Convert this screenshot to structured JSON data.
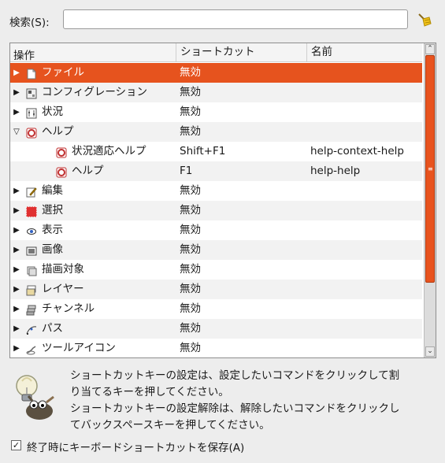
{
  "search": {
    "label": "検索(S):",
    "value": "",
    "placeholder": ""
  },
  "tree": {
    "columns": [
      "操作",
      "ショートカット",
      "名前"
    ],
    "rows": [
      {
        "expander": "▶",
        "icon": "file-icon",
        "name": "ファイル",
        "shortcut": "無効",
        "action": "",
        "selected": true,
        "depth": 0
      },
      {
        "expander": "▶",
        "icon": "configuration-icon",
        "name": "コンフィグレーション",
        "shortcut": "無効",
        "action": "",
        "depth": 0
      },
      {
        "expander": "▶",
        "icon": "status-icon",
        "name": "状況",
        "shortcut": "無効",
        "action": "",
        "depth": 0
      },
      {
        "expander": "▽",
        "icon": "help-icon",
        "name": "ヘルプ",
        "shortcut": "無効",
        "action": "",
        "depth": 0
      },
      {
        "expander": "",
        "icon": "help-icon",
        "name": "状況適応ヘルプ",
        "shortcut": "Shift+F1",
        "action": "help-context-help",
        "depth": 1
      },
      {
        "expander": "",
        "icon": "help-icon",
        "name": "ヘルプ",
        "shortcut": "F1",
        "action": "help-help",
        "depth": 1
      },
      {
        "expander": "▶",
        "icon": "edit-icon",
        "name": "編集",
        "shortcut": "無効",
        "action": "",
        "depth": 0
      },
      {
        "expander": "▶",
        "icon": "select-icon",
        "name": "選択",
        "shortcut": "無効",
        "action": "",
        "depth": 0
      },
      {
        "expander": "▶",
        "icon": "view-icon",
        "name": "表示",
        "shortcut": "無効",
        "action": "",
        "depth": 0
      },
      {
        "expander": "▶",
        "icon": "image-icon",
        "name": "画像",
        "shortcut": "無効",
        "action": "",
        "depth": 0
      },
      {
        "expander": "▶",
        "icon": "drawable-icon",
        "name": "描画対象",
        "shortcut": "無効",
        "action": "",
        "depth": 0
      },
      {
        "expander": "▶",
        "icon": "layer-icon",
        "name": "レイヤー",
        "shortcut": "無効",
        "action": "",
        "depth": 0
      },
      {
        "expander": "▶",
        "icon": "channel-icon",
        "name": "チャンネル",
        "shortcut": "無効",
        "action": "",
        "depth": 0
      },
      {
        "expander": "▶",
        "icon": "path-icon",
        "name": "パス",
        "shortcut": "無効",
        "action": "",
        "depth": 0
      },
      {
        "expander": "▶",
        "icon": "tool-icon",
        "name": "ツールアイコン",
        "shortcut": "無効",
        "action": "",
        "depth": 0
      }
    ]
  },
  "tip": {
    "text": "ショートカットキーの設定は、設定したいコマンドをクリックして割\nり当てるキーを押してください。\nショートカットキーの設定解除は、解除したいコマンドをクリックし\nてバックスペースキーを押してください。"
  },
  "save": {
    "label": "終了時にキーボードショートカットを保存(A)",
    "checked": true
  },
  "colors": {
    "accent": "#e6531e",
    "background": "#ededed"
  }
}
